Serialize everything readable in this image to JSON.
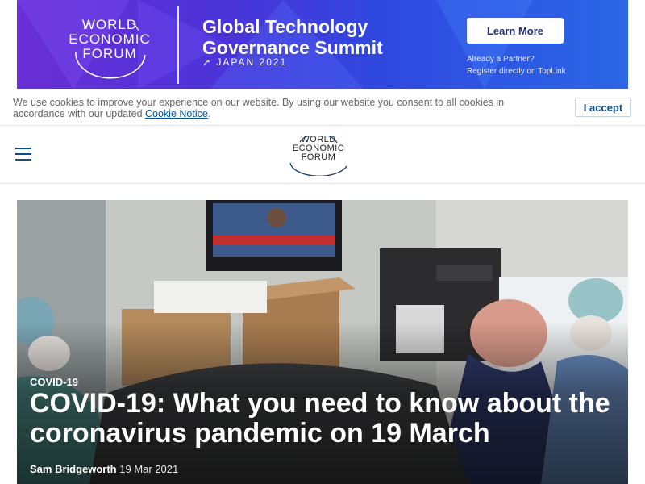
{
  "banner": {
    "logo_lines": [
      "WORLD",
      "ECONOMIC",
      "FORUM"
    ],
    "title_line1": "Global Technology",
    "title_line2": "Governance Summit",
    "subtitle": "JAPAN 2021",
    "button_label": "Learn More",
    "partner_line1": "Already a Partner?",
    "partner_line2": "Register directly on TopLink",
    "colors": {
      "start": "#6a2fd6",
      "end": "#2b67e6"
    }
  },
  "cookie": {
    "text_before_link": "We use cookies to improve your experience on our website. By using our website you consent to all cookies in accordance with our updated ",
    "link_label": "Cookie Notice",
    "text_after_link": ".",
    "accept_label": "I accept"
  },
  "header": {
    "logo_lines": [
      "WORLD",
      "ECONOMIC",
      "FORUM"
    ],
    "menu_icon": "hamburger-menu-icon",
    "accent_color": "#0a4d8c"
  },
  "hero": {
    "tag": "COVID-19",
    "title": "COVID-19: What you need to know about the coronavirus pandemic on 19 March",
    "author": "Sam Bridgeworth",
    "date": "19 Mar 2021"
  }
}
